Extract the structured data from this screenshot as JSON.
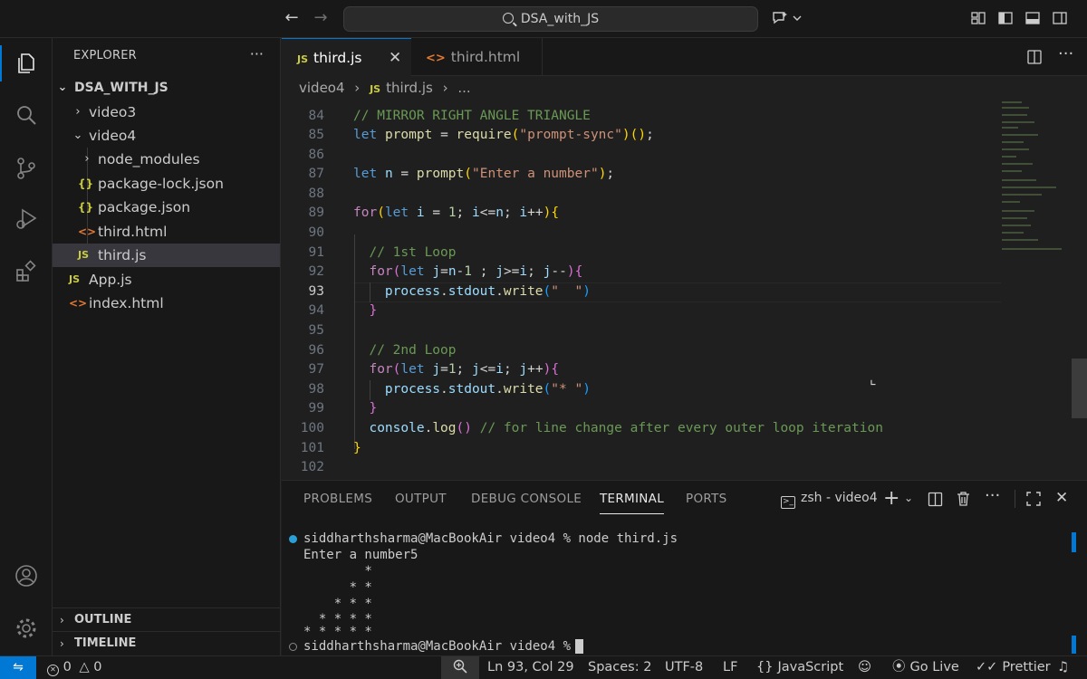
{
  "titlebar": {
    "search_text": "DSA_with_JS"
  },
  "sidebar": {
    "title": "EXPLORER",
    "more": "···",
    "root": "DSA_WITH_JS",
    "items": [
      {
        "label": "video3",
        "type": "folder",
        "expanded": false
      },
      {
        "label": "video4",
        "type": "folder",
        "expanded": true
      },
      {
        "label": "node_modules",
        "type": "folder",
        "expanded": false
      },
      {
        "label": "package-lock.json",
        "type": "json"
      },
      {
        "label": "package.json",
        "type": "json"
      },
      {
        "label": "third.html",
        "type": "html"
      },
      {
        "label": "third.js",
        "type": "js",
        "selected": true
      },
      {
        "label": "App.js",
        "type": "js"
      },
      {
        "label": "index.html",
        "type": "html"
      }
    ],
    "outline": "OUTLINE",
    "timeline": "TIMELINE"
  },
  "icons": {
    "js": "JS",
    "html": "<>",
    "json": "{}"
  },
  "tabs": [
    {
      "label": "third.js",
      "active": true
    },
    {
      "label": "third.html",
      "active": false
    }
  ],
  "breadcrumb": {
    "folder": "video4",
    "file": "third.js",
    "rest": "..."
  },
  "editor": {
    "line_numbers": [
      "84",
      "85",
      "86",
      "87",
      "88",
      "89",
      "90",
      "91",
      "92",
      "93",
      "94",
      "95",
      "96",
      "97",
      "98",
      "99",
      "100",
      "101",
      "102"
    ],
    "current_line": "93"
  },
  "panel": {
    "tabs": [
      "PROBLEMS",
      "OUTPUT",
      "DEBUG CONSOLE",
      "TERMINAL",
      "PORTS"
    ],
    "active_tab": "TERMINAL",
    "terminal_name": "zsh - video4",
    "terminal_lines": [
      "siddharthsharma@MacBookAir video4 % node third.js",
      "Enter a number5",
      "        *",
      "      * *",
      "    * * *",
      "  * * * *",
      "* * * * *",
      "siddharthsharma@MacBookAir video4 % "
    ]
  },
  "statusbar": {
    "errors": "0",
    "warnings": "0",
    "position": "Ln 93, Col 29",
    "spaces": "Spaces: 2",
    "encoding": "UTF-8",
    "eol": "LF",
    "language": "JavaScript",
    "go_live": "Go Live",
    "prettier": "Prettier"
  },
  "colors": {
    "accent": "#0078d4",
    "keyword": "#569cd6",
    "control": "#c586c0",
    "comment": "#6a9955",
    "string": "#ce9178",
    "function": "#dcdcaa",
    "variable": "#9cdcfe",
    "number": "#b5cea8"
  }
}
